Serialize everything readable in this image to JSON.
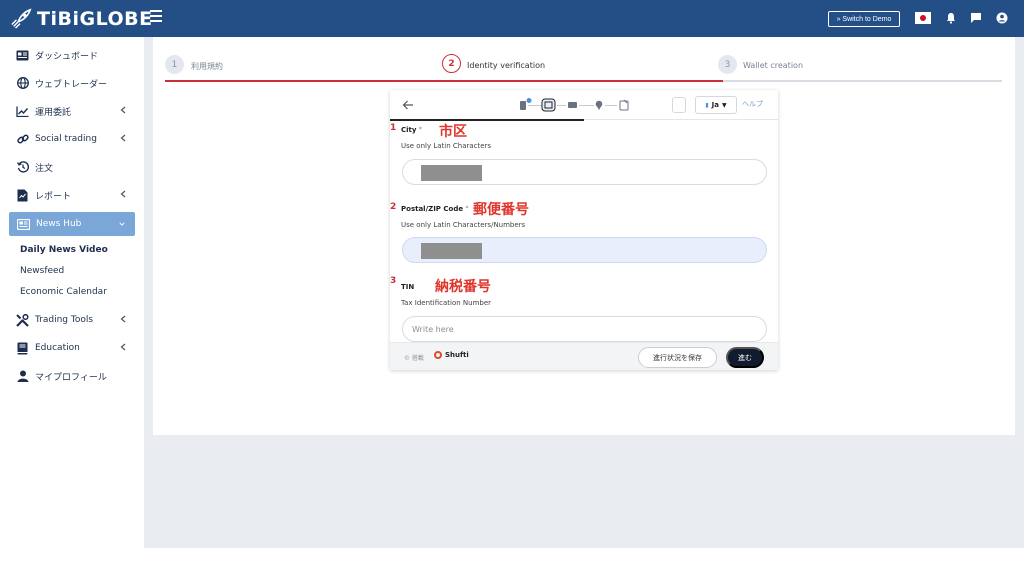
{
  "app": {
    "logo_text": "TiBiGLOBE"
  },
  "topbar": {
    "switch_demo_label": "» Switch to Demo",
    "flag": "japan-flag",
    "icons": [
      "bell-icon",
      "chat-icon",
      "user-circle-icon"
    ]
  },
  "sidebar": {
    "items": [
      {
        "label": "ダッシュボード",
        "icon": "dashboard-icon",
        "chevron": false
      },
      {
        "label": "ウェブトレーダー",
        "icon": "globe-icon",
        "chevron": false
      },
      {
        "label": "運用委託",
        "icon": "chart-line-icon",
        "chevron": true
      },
      {
        "label": "Social trading",
        "icon": "link-icon",
        "chevron": true
      },
      {
        "label": "注文",
        "icon": "history-icon",
        "chevron": false
      },
      {
        "label": "レポート",
        "icon": "report-icon",
        "chevron": true
      },
      {
        "label": "News Hub",
        "icon": "newspaper-icon",
        "chevron": true,
        "active": true
      },
      {
        "label": "Trading Tools",
        "icon": "tools-icon",
        "chevron": true
      },
      {
        "label": "Education",
        "icon": "book-icon",
        "chevron": true
      },
      {
        "label": "マイプロフィール",
        "icon": "user-icon",
        "chevron": false
      }
    ],
    "news_hub_subitems": [
      {
        "label": "Daily News Video",
        "bold": true
      },
      {
        "label": "Newsfeed",
        "bold": false
      },
      {
        "label": "Economic Calendar",
        "bold": false
      }
    ]
  },
  "stepper": {
    "steps": [
      {
        "number": "1",
        "label": "利用規約",
        "active": false
      },
      {
        "number": "2",
        "label": "Identity verification",
        "active": true
      },
      {
        "number": "3",
        "label": "Wallet creation",
        "active": false
      }
    ]
  },
  "widget": {
    "lang": "Ja",
    "help": "ヘルプ",
    "fields": [
      {
        "number": "1",
        "label": "City",
        "required_mark": "*",
        "annotation": "市区",
        "hint": "Use only Latin Characters",
        "value": "",
        "placeholder": "",
        "redacted": true,
        "focused": false
      },
      {
        "number": "2",
        "label": "Postal/ZIP Code",
        "required_mark": "*",
        "annotation": "郵便番号",
        "hint": "Use only Latin Characters/Numbers",
        "value": "",
        "placeholder": "",
        "redacted": true,
        "focused": true
      },
      {
        "number": "3",
        "label": "TIN",
        "required_mark": "",
        "annotation": "納税番号",
        "hint": "Tax Identification Number",
        "value": "",
        "placeholder": "Write here",
        "redacted": false,
        "focused": false
      }
    ],
    "footer": {
      "powered_by": "© 搭載",
      "brand": "Shufti",
      "save_label": "進行状況を保存",
      "next_label": "進む"
    }
  },
  "colors": {
    "topbar": "#234e86",
    "accent_red": "#c9303a",
    "annotation_red": "#e0352b",
    "nav_active": "#7ba7d8",
    "next_button": "#111b30"
  }
}
